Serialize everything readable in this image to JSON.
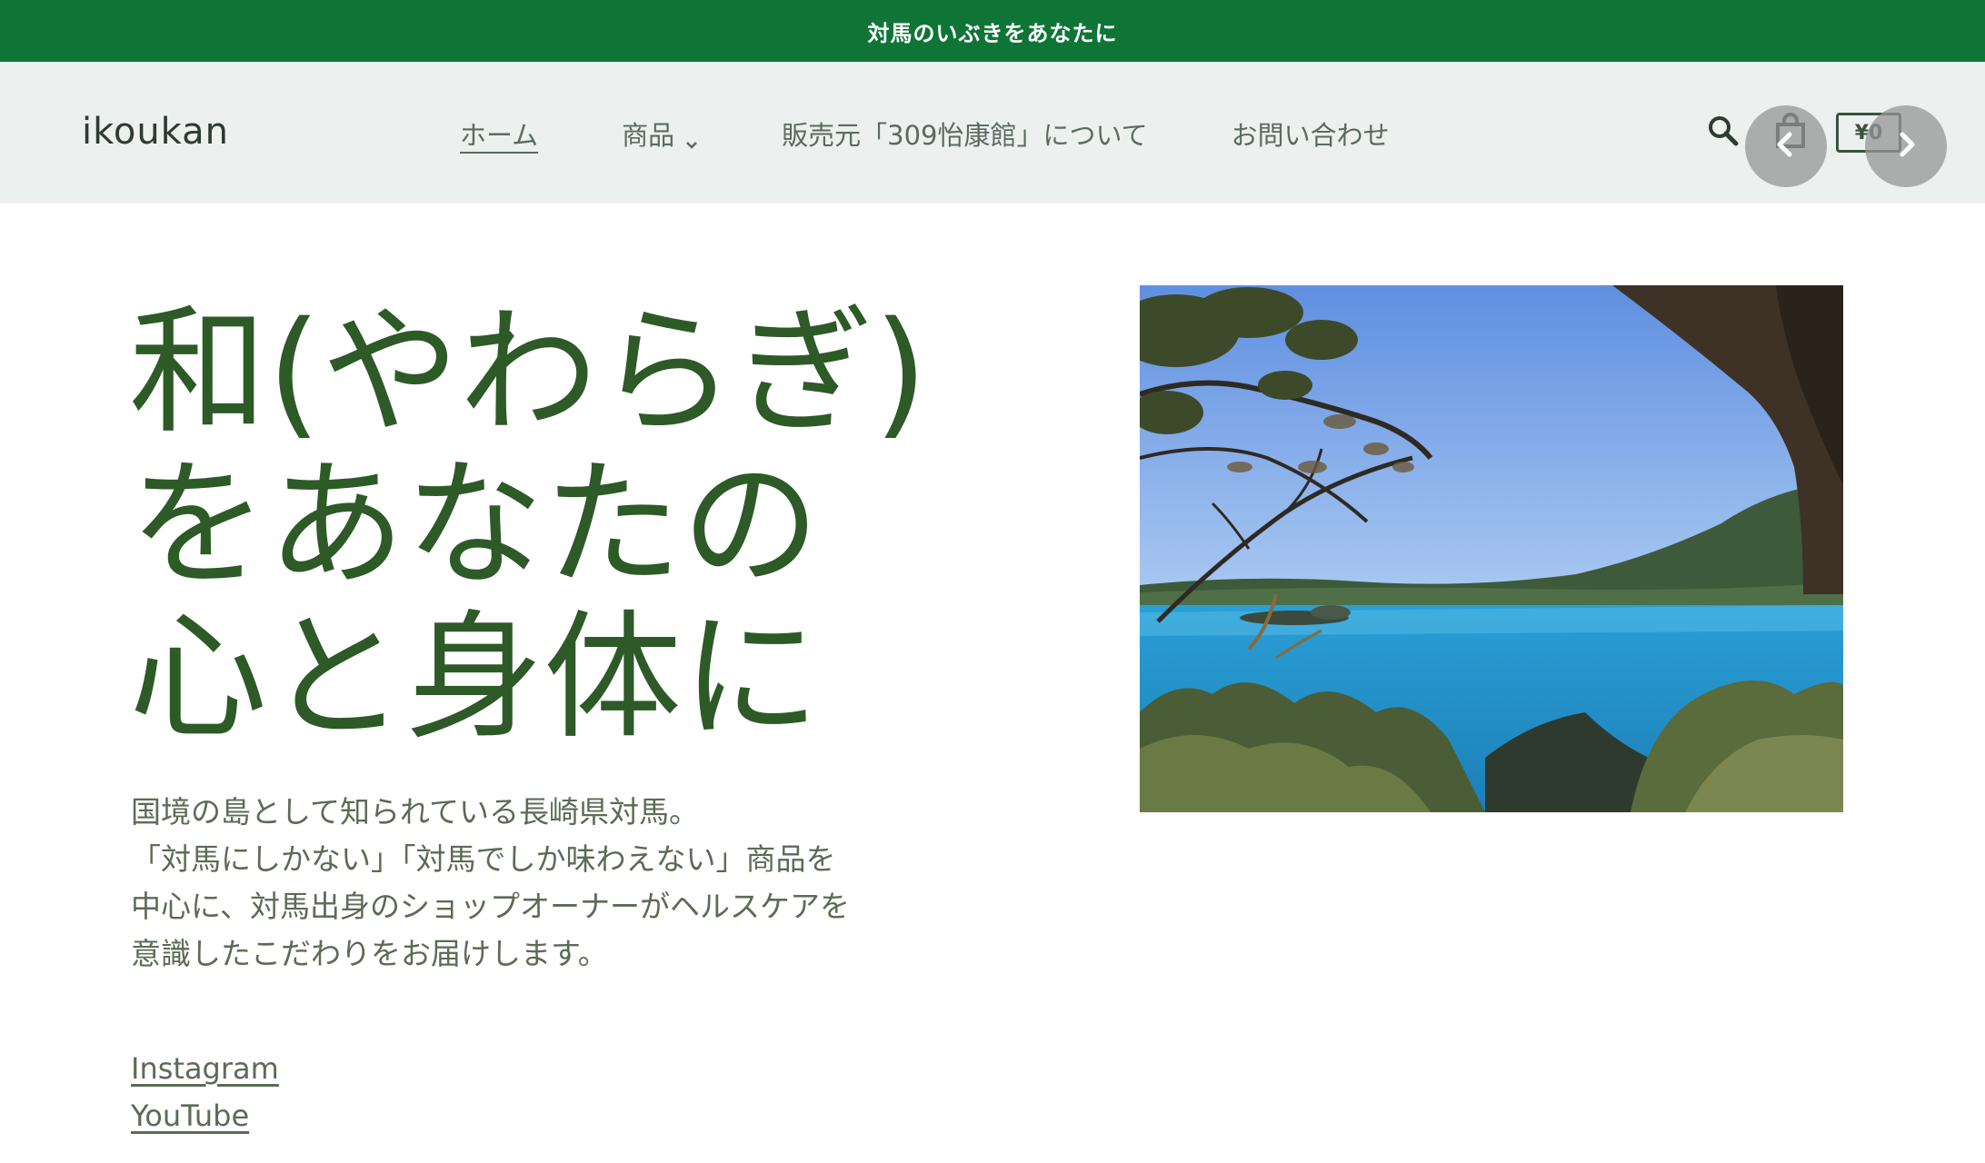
{
  "announcement": {
    "text": "対馬のいぶきをあなたに"
  },
  "header": {
    "logo": "ikoukan",
    "nav": [
      {
        "label": "ホーム"
      },
      {
        "label": "商品"
      },
      {
        "label": "販売元「309怡康館」について"
      },
      {
        "label": "お問い合わせ"
      }
    ],
    "cart_total": "¥0",
    "icons": {
      "search": "search-icon",
      "cart": "shopping-bag-icon",
      "prev": "chevron-left-icon",
      "next": "chevron-right-icon",
      "dropdown": "chevron-down-icon"
    }
  },
  "hero": {
    "title_lines": [
      "和(やわらぎ)",
      "をあなたの",
      "心と身体に"
    ],
    "description_lines": [
      "国境の島として知られている長崎県対馬。",
      "「対馬にしかない」「対馬でしか味わえない」商品を",
      "中心に、対馬出身のショップオーナーがヘルスケアを",
      "意識したこだわりをお届けします。"
    ],
    "links": [
      {
        "label": "Instagram"
      },
      {
        "label": "YouTube"
      }
    ]
  },
  "colors": {
    "announcement_bg": "#0f7537",
    "header_bg": "#ecf0ee",
    "title": "#2d5a27",
    "body_text": "#5c6b55"
  }
}
